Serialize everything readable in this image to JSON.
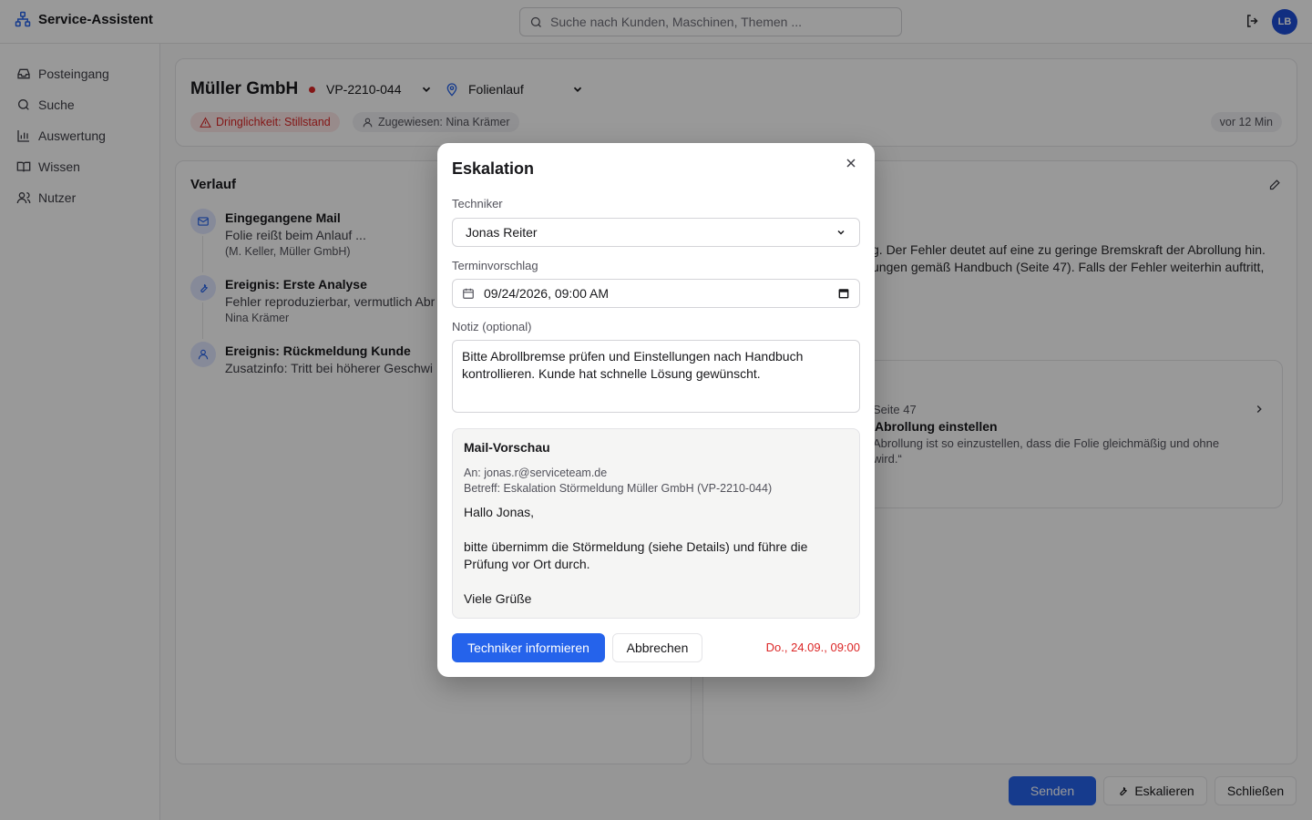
{
  "app": {
    "title": "Service-Assistent",
    "user_initials": "LB"
  },
  "search": {
    "placeholder": "Suche nach Kunden, Maschinen, Themen ..."
  },
  "sidebar": {
    "items": [
      {
        "label": "Posteingang",
        "icon": "inbox-icon"
      },
      {
        "label": "Suche",
        "icon": "search-icon"
      },
      {
        "label": "Auswertung",
        "icon": "bar-chart-icon"
      },
      {
        "label": "Wissen",
        "icon": "book-icon"
      },
      {
        "label": "Nutzer",
        "icon": "users-icon"
      }
    ]
  },
  "ticket": {
    "customer": "Müller GmbH",
    "machine": "VP-2210-044",
    "topic": "Folienlauf",
    "urgency": "Dringlichkeit: Stillstand",
    "assigned": "Zugewiesen: Nina Krämer",
    "age": "vor 12 Min",
    "status_color": "#dc2626"
  },
  "history": {
    "title": "Verlauf",
    "items": [
      {
        "title": "Eingegangene Mail",
        "desc": "Folie reißt beim Anlauf ...",
        "meta": "(M. Keller, Müller GmbH)",
        "icon": "mail-icon"
      },
      {
        "title": "Ereignis: Erste Analyse",
        "desc": "Fehler reproduzierbar, vermutlich Abr",
        "meta": "Nina Krämer",
        "icon": "wrench-icon"
      },
      {
        "title": "Ereignis: Rückmeldung Kunde",
        "desc": "Zusatzinfo: Tritt bei höherer Geschwi",
        "meta": "",
        "icon": "user-icon"
      }
    ]
  },
  "analysis": {
    "line1": "g. Der Fehler deutet auf eine zu geringe Bremskraft der Abrollung hin.",
    "line2": "ungen gemäß Handbuch (Seite 47). Falls der Fehler weiterhin auftritt,",
    "source_page": "Seite 47",
    "source_title": "Abrollung einstellen",
    "source_quote1": "Abrollung ist so einzustellen, dass die Folie gleichmäßig und ohne",
    "source_quote2": "wird.“"
  },
  "footer": {
    "send": "Senden",
    "escalate": "Eskalieren",
    "close": "Schließen"
  },
  "modal": {
    "title": "Eskalation",
    "technician_label": "Techniker",
    "technician_value": "Jonas Reiter",
    "date_label": "Terminvorschlag",
    "date_value": "09/24/2026, 09:00 AM",
    "note_label": "Notiz (optional)",
    "note_value": "Bitte Abrollbremse prüfen und Einstellungen nach Handbuch\nkontrollieren. Kunde hat schnelle Lösung gewünscht.",
    "preview_title": "Mail-Vorschau",
    "preview_to": "An: jonas.r@serviceteam.de",
    "preview_subject": "Betreff: Eskalation Störmeldung Müller GmbH (VP-2210-044)",
    "preview_body": "Hallo Jonas,\n\nbitte übernimm die Störmeldung (siehe Details) und führe die\nPrüfung vor Ort durch.\n\nViele Grüße",
    "primary_button": "Techniker informieren",
    "cancel_button": "Abbrechen",
    "scheduled": "Do., 24.09., 09:00"
  }
}
